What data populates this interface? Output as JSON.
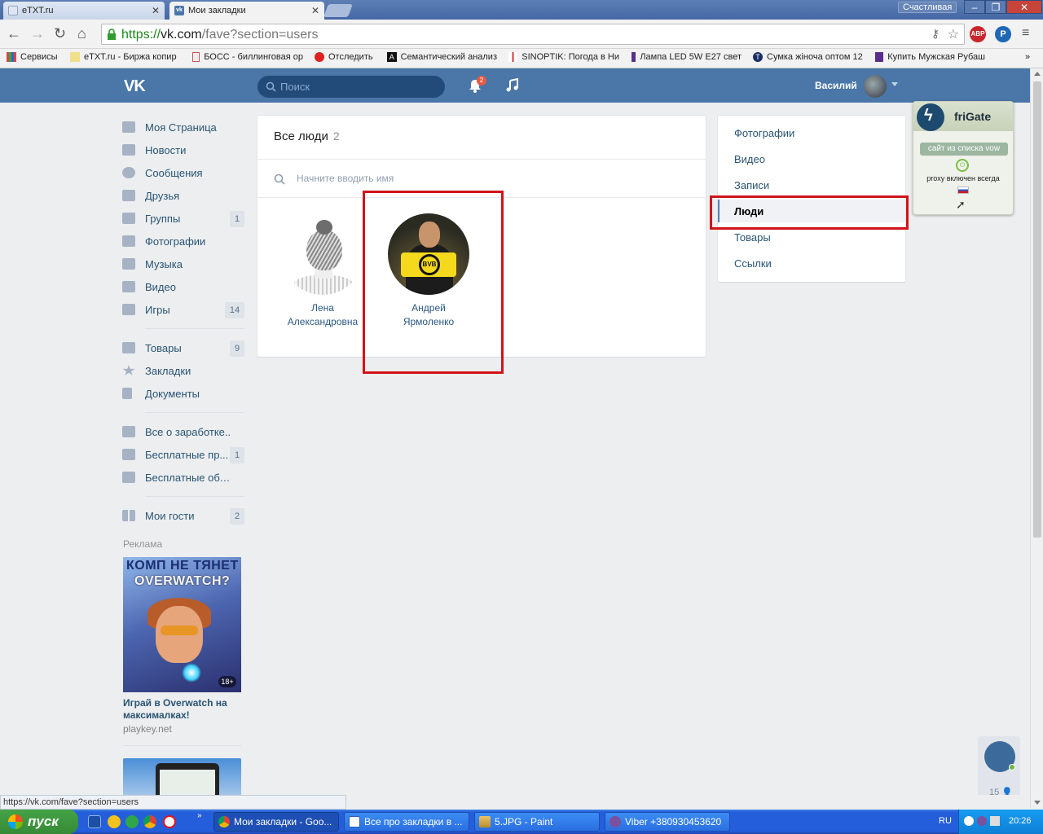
{
  "browser": {
    "tabs": [
      {
        "title": "eTXT.ru",
        "active": false
      },
      {
        "title": "Мои закладки",
        "active": true
      }
    ],
    "profile_name": "Счастливая",
    "url_scheme": "https://",
    "url_host": "vk.com",
    "url_path": "/fave?section=users",
    "status_url": "https://vk.com/fave?section=users",
    "bookmarks": [
      "Сервисы",
      "eTXT.ru - Биржа копир",
      "БОСС - биллинговая ор",
      "Отследить",
      "Семантический анализ",
      "SINOPTIK: Погода в Ни",
      "Лампа LED 5W E27 свет",
      "Сумка жіноча оптом 12",
      "Купить Мужская Рубаш"
    ],
    "ext_abp": "ABP",
    "ext_p": "P"
  },
  "vk": {
    "logo": "VK",
    "search_placeholder": "Поиск",
    "notif_count": "2",
    "user_name": "Василий",
    "left_nav": [
      {
        "label": "Моя Страница",
        "count": ""
      },
      {
        "label": "Новости",
        "count": ""
      },
      {
        "label": "Сообщения",
        "count": ""
      },
      {
        "label": "Друзья",
        "count": ""
      },
      {
        "label": "Группы",
        "count": "1"
      },
      {
        "label": "Фотографии",
        "count": ""
      },
      {
        "label": "Музыка",
        "count": ""
      },
      {
        "label": "Видео",
        "count": ""
      },
      {
        "label": "Игры",
        "count": "14"
      }
    ],
    "left_nav2": [
      {
        "label": "Товары",
        "count": "9"
      },
      {
        "label": "Закладки",
        "count": ""
      },
      {
        "label": "Документы",
        "count": ""
      }
    ],
    "left_nav3": [
      {
        "label": "Все о заработке..",
        "count": ""
      },
      {
        "label": "Бесплатные пр...",
        "count": "1"
      },
      {
        "label": "Бесплатные объя..",
        "count": ""
      }
    ],
    "left_nav4": [
      {
        "label": "Мои гости",
        "count": "2"
      }
    ],
    "ad_label": "Реклама",
    "ad_line1": "КОМП НЕ ТЯНЕТ",
    "ad_line2": "OVERWATCH?",
    "ad_age": "18+",
    "ad_title": "Играй в Overwatch на максималках!",
    "ad_domain": "playkey.net",
    "people_title": "Все люди",
    "people_count": "2",
    "people_search_placeholder": "Начните вводить имя",
    "people": [
      {
        "first": "Лена",
        "last": "Александровна"
      },
      {
        "first": "Андрей",
        "last": "Ярмоленко"
      }
    ],
    "filters": [
      "Фотографии",
      "Видео",
      "Записи",
      "Люди",
      "Товары",
      "Ссылки"
    ],
    "selected_filter": "Люди",
    "chat_online_count": "15"
  },
  "frigate": {
    "name": "friGate",
    "pill": "сайт из списка vow",
    "proxy": "proxy включен всегда"
  },
  "taskbar": {
    "start": "пуск",
    "buttons": [
      "Мои закладки - Goo...",
      "Все про закладки в ...",
      "5.JPG - Paint",
      "Viber +380930453620"
    ],
    "lang": "RU",
    "time": "20:26"
  },
  "colors": {
    "vk_header": "#4a76a8",
    "highlight_red": "#d0141a",
    "link": "#2a5885"
  }
}
